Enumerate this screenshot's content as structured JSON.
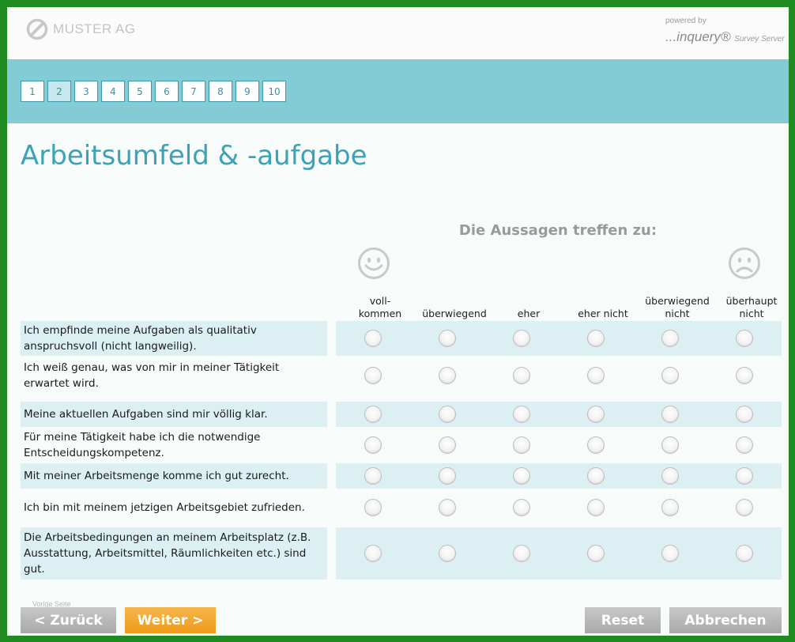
{
  "header": {
    "brand": "MUSTER AG",
    "powered_label": "powered by",
    "powered_brand": "inquery",
    "powered_sub": "Survey Server"
  },
  "pager": {
    "pages": [
      "1",
      "2",
      "3",
      "4",
      "5",
      "6",
      "7",
      "8",
      "9",
      "10"
    ],
    "current": "2"
  },
  "page_title": "Arbeitsumfeld & -aufgabe",
  "scale": {
    "title": "Die Aussagen treffen zu:",
    "left_icon": "smiley-happy-icon",
    "right_icon": "smiley-sad-icon",
    "columns": [
      "voll-\nkommen",
      "überwiegend",
      "eher",
      "eher nicht",
      "überwiegend\nnicht",
      "überhaupt\nnicht"
    ]
  },
  "statements": [
    "Ich empfinde meine Aufgaben als qualitativ anspruchsvoll (nicht langweilig).",
    "Ich weiß genau, was von mir in meiner Tätigkeit erwartet wird.",
    "Meine aktuellen Aufgaben sind mir völlig klar.",
    "Für meine Tätigkeit habe ich die notwendige Entscheidungskompetenz.",
    "Mit meiner Arbeitsmenge komme ich gut zurecht.",
    "Ich bin mit meinem jetzigen Arbeitsgebiet zufrieden.",
    "Die Arbeitsbedingungen an meinem Arbeitsplatz (z.B. Ausstattung, Arbeitsmittel, Räumlichkeiten etc.) sind gut."
  ],
  "footer": {
    "tiny_label": "Vorige Seite",
    "back_label": "< Zurück",
    "next_label": "Weiter >",
    "reset_label": "Reset",
    "cancel_label": "Abbrechen"
  },
  "colors": {
    "frame": "#1f8a1f",
    "band": "#83cbd5",
    "accent": "#3aa3b5",
    "row_shade": "#dcf0f4",
    "next_button": "#f0a020"
  }
}
